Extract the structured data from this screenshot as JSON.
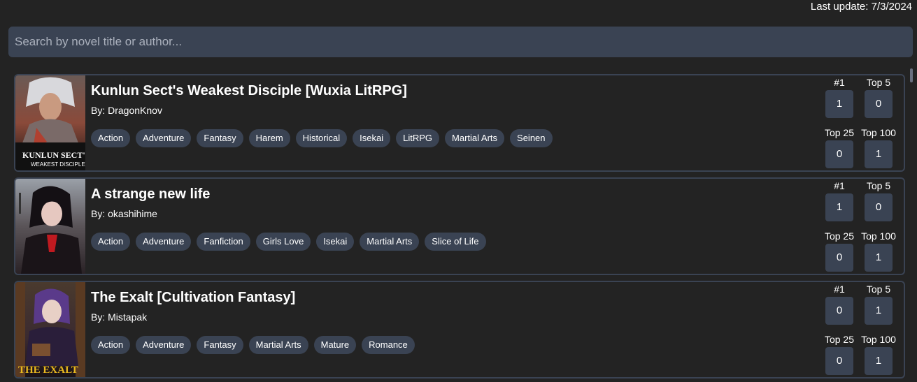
{
  "header": {
    "last_update": "Last update: 7/3/2024"
  },
  "search": {
    "placeholder": "Search by novel title or author..."
  },
  "stat_labels": {
    "first": "#1",
    "top5": "Top 5",
    "top25": "Top 25",
    "top100": "Top 100"
  },
  "novels": [
    {
      "title": "Kunlun Sect's Weakest Disciple [Wuxia LitRPG]",
      "author": "By: DragonKnov",
      "cover_text": [
        "KUNLUN SECT'S",
        "WEAKEST DISCIPLE"
      ],
      "tags": [
        "Action",
        "Adventure",
        "Fantasy",
        "Harem",
        "Historical",
        "Isekai",
        "LitRPG",
        "Martial Arts",
        "Seinen"
      ],
      "stats": {
        "first": "1",
        "top5": "0",
        "top25": "0",
        "top100": "1"
      }
    },
    {
      "title": "A strange new life",
      "author": "By: okashihime",
      "cover_text": [],
      "tags": [
        "Action",
        "Adventure",
        "Fanfiction",
        "Girls Love",
        "Isekai",
        "Martial Arts",
        "Slice of Life"
      ],
      "stats": {
        "first": "1",
        "top5": "0",
        "top25": "0",
        "top100": "1"
      }
    },
    {
      "title": "The Exalt [Cultivation Fantasy]",
      "author": "By: Mistapak",
      "cover_text": [
        "THE EXALT"
      ],
      "tags": [
        "Action",
        "Adventure",
        "Fantasy",
        "Martial Arts",
        "Mature",
        "Romance"
      ],
      "stats": {
        "first": "0",
        "top5": "1",
        "top25": "0",
        "top100": "1"
      }
    }
  ]
}
